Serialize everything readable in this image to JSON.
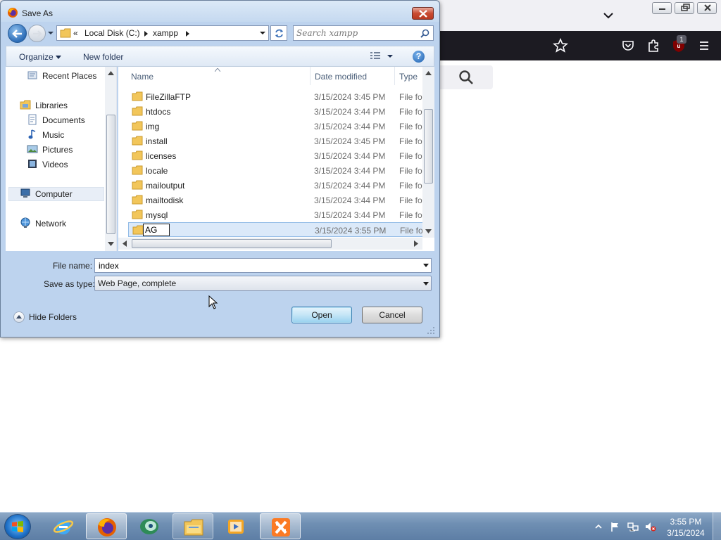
{
  "dialog": {
    "title": "Save As",
    "address": {
      "overflow": "«",
      "crumbs": [
        "Local Disk (C:)",
        "xampp"
      ]
    },
    "search_placeholder": "Search xampp",
    "commands": {
      "organize": "Organize",
      "new_folder": "New folder"
    },
    "help_label": "?",
    "nav": {
      "recent_places": "Recent Places",
      "libraries": "Libraries",
      "documents": "Documents",
      "music": "Music",
      "pictures": "Pictures",
      "videos": "Videos",
      "computer": "Computer",
      "network": "Network"
    },
    "columns": {
      "name": "Name",
      "date": "Date modified",
      "type": "Type"
    },
    "files": [
      {
        "name": "FileZillaFTP",
        "date": "3/15/2024 3:45 PM",
        "type": "File fol"
      },
      {
        "name": "htdocs",
        "date": "3/15/2024 3:44 PM",
        "type": "File fol"
      },
      {
        "name": "img",
        "date": "3/15/2024 3:44 PM",
        "type": "File fol"
      },
      {
        "name": "install",
        "date": "3/15/2024 3:45 PM",
        "type": "File fol"
      },
      {
        "name": "licenses",
        "date": "3/15/2024 3:44 PM",
        "type": "File fol"
      },
      {
        "name": "locale",
        "date": "3/15/2024 3:44 PM",
        "type": "File fol"
      },
      {
        "name": "mailoutput",
        "date": "3/15/2024 3:44 PM",
        "type": "File fol"
      },
      {
        "name": "mailtodisk",
        "date": "3/15/2024 3:44 PM",
        "type": "File fol"
      },
      {
        "name": "mysql",
        "date": "3/15/2024 3:44 PM",
        "type": "File fol"
      }
    ],
    "renaming": {
      "value": "AG",
      "date": "3/15/2024 3:55 PM",
      "type": "File fol"
    },
    "file_name_label": "File name:",
    "file_name_value": "index",
    "save_type_label": "Save as type:",
    "save_type_value": "Web Page, complete",
    "hide_folders": "Hide Folders",
    "open_button": "Open",
    "cancel_button": "Cancel"
  },
  "browser": {
    "ublock_badge": "1"
  },
  "taskbar": {
    "apps": [
      "internet-explorer",
      "firefox",
      "bitcoin-app",
      "file-explorer",
      "media-player",
      "xampp"
    ],
    "clock_time": "3:55 PM",
    "clock_date": "3/15/2024"
  },
  "colors": {
    "dialog_frame": "#bdd3ee",
    "browser_toolbar": "#1c1b22",
    "selection": "#dbe9f9",
    "taskbar": "#6f8fb3"
  }
}
